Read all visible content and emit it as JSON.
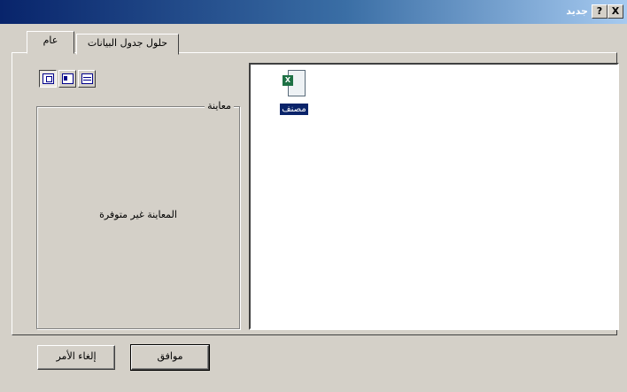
{
  "window": {
    "title": "جديد",
    "help_label": "?",
    "close_label": "X"
  },
  "tabs": {
    "general": "عام",
    "solutions": "حلول جدول البيانات"
  },
  "preview": {
    "title": "معاينة",
    "message": "المعاينة غير متوفرة"
  },
  "files": [
    {
      "label": "مصنف",
      "icon": "excel-workbook-icon",
      "badge": "X"
    }
  ],
  "buttons": {
    "ok": "موافق",
    "cancel": "إلغاء الأمر"
  }
}
